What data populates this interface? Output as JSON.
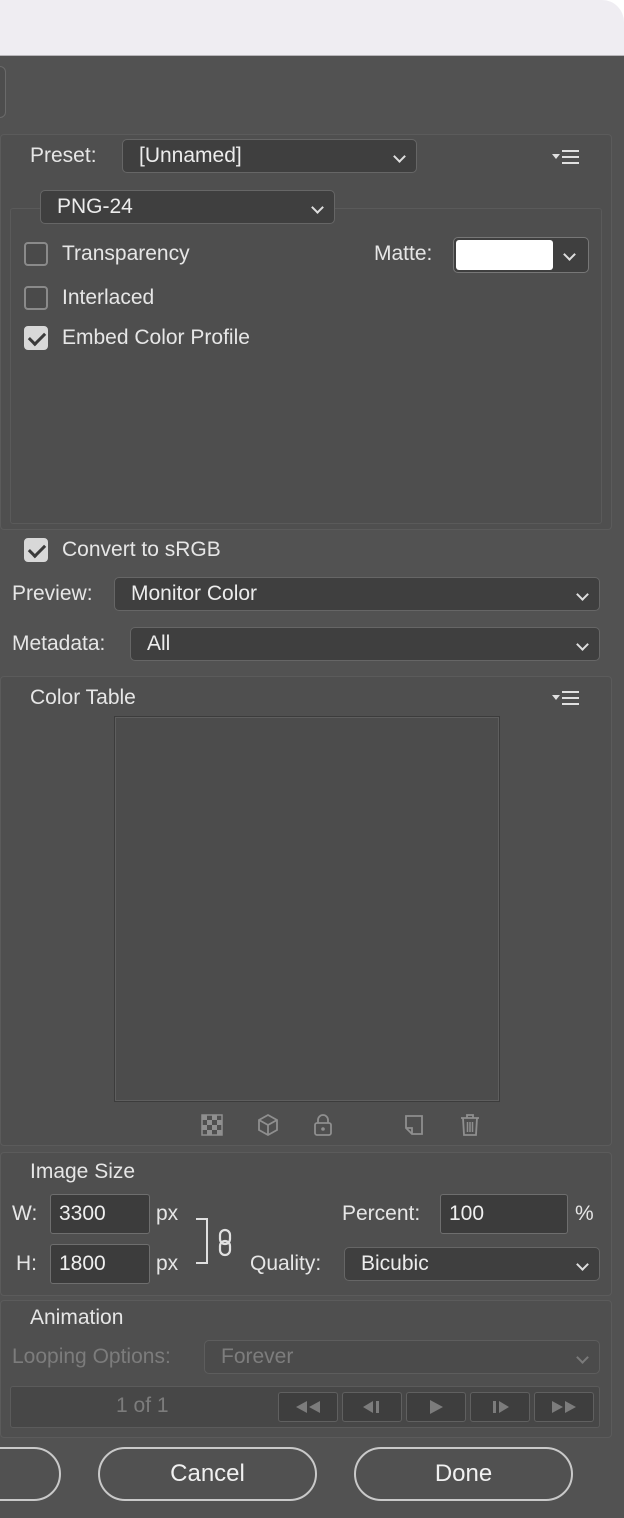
{
  "preset": {
    "label": "Preset:",
    "value": "[Unnamed]"
  },
  "format": {
    "value": "PNG-24"
  },
  "options": {
    "transparency": {
      "label": "Transparency",
      "checked": false
    },
    "interlaced": {
      "label": "Interlaced",
      "checked": false
    },
    "embed_color_profile": {
      "label": "Embed Color Profile",
      "checked": true
    },
    "matte": {
      "label": "Matte:",
      "color": "#ffffff"
    }
  },
  "convert_srgb": {
    "label": "Convert to sRGB",
    "checked": true
  },
  "preview": {
    "label": "Preview:",
    "value": "Monitor Color"
  },
  "metadata": {
    "label": "Metadata:",
    "value": "All"
  },
  "color_table": {
    "heading": "Color Table",
    "tools": [
      "checkerboard-icon",
      "cube-icon",
      "lock-icon",
      "new-color-icon",
      "trash-icon"
    ]
  },
  "image_size": {
    "heading": "Image Size",
    "width_label": "W:",
    "width": "3300",
    "width_unit": "px",
    "height_label": "H:",
    "height": "1800",
    "height_unit": "px",
    "percent_label": "Percent:",
    "percent": "100",
    "percent_unit": "%",
    "quality_label": "Quality:",
    "quality": "Bicubic"
  },
  "animation": {
    "heading": "Animation",
    "looping_label": "Looping Options:",
    "looping_value": "Forever",
    "frame_counter": "1 of 1"
  },
  "buttons": {
    "cancel": "Cancel",
    "done": "Done"
  },
  "colors": {
    "panel": "#525252",
    "titlebar": "#efedf2"
  }
}
